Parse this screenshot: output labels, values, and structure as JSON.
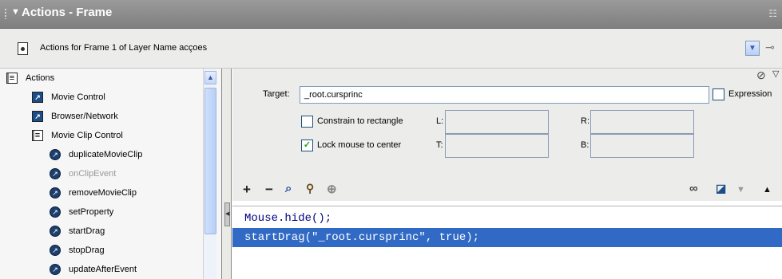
{
  "panel": {
    "title": "Actions - Frame"
  },
  "frame_bar": {
    "label": "Actions for Frame 1 of Layer Name acçoes"
  },
  "tree": {
    "items": [
      {
        "label": "Actions",
        "icon": "book-icon",
        "level": 0,
        "disabled": false
      },
      {
        "label": "Movie Control",
        "icon": "arrow-box-icon",
        "level": 1,
        "disabled": false
      },
      {
        "label": "Browser/Network",
        "icon": "arrow-box-icon",
        "level": 1,
        "disabled": false
      },
      {
        "label": "Movie Clip Control",
        "icon": "book-icon",
        "level": 1,
        "disabled": false
      },
      {
        "label": "duplicateMovieClip",
        "icon": "action-circle-icon",
        "level": 2,
        "disabled": false
      },
      {
        "label": "onClipEvent",
        "icon": "action-circle-icon",
        "level": 2,
        "disabled": true
      },
      {
        "label": "removeMovieClip",
        "icon": "action-circle-icon",
        "level": 2,
        "disabled": false
      },
      {
        "label": "setProperty",
        "icon": "action-circle-icon",
        "level": 2,
        "disabled": false
      },
      {
        "label": "startDrag",
        "icon": "action-circle-icon",
        "level": 2,
        "disabled": false
      },
      {
        "label": "stopDrag",
        "icon": "action-circle-icon",
        "level": 2,
        "disabled": false
      },
      {
        "label": "updateAfterEvent",
        "icon": "action-circle-icon",
        "level": 2,
        "disabled": false
      }
    ]
  },
  "params": {
    "target_label": "Target:",
    "target_value": "_root.cursprinc",
    "expression_label": "Expression",
    "expression_checked": false,
    "constrain_label": "Constrain to rectangle",
    "constrain_checked": false,
    "lock_label": "Lock mouse to center",
    "lock_checked": true,
    "l_label": "L:",
    "r_label": "R:",
    "t_label": "T:",
    "b_label": "B:",
    "l_value": "",
    "r_value": "",
    "t_value": "",
    "b_value": ""
  },
  "toolbar": {
    "add": "+",
    "remove": "−"
  },
  "code": {
    "lines": [
      {
        "text": "Mouse.hide();",
        "selected": false
      },
      {
        "text": "startDrag(\"_root.cursprinc\", true);",
        "selected": true
      }
    ]
  }
}
